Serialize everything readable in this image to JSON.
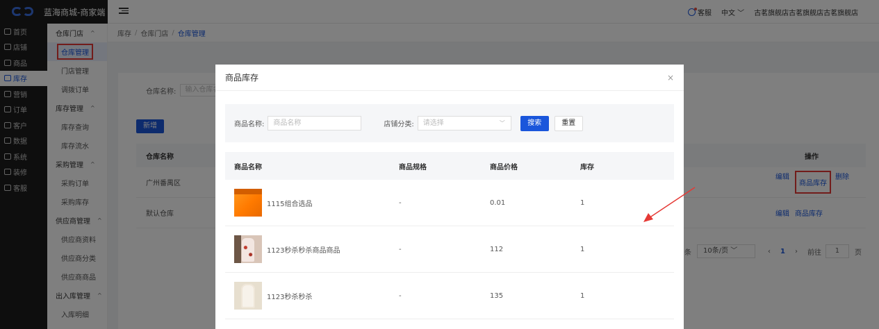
{
  "app": {
    "title": "蓝海商城-商家端",
    "service_label": "客服",
    "language": "中文",
    "store_name": "古茗旗舰店古茗旗舰店古茗旗舰店"
  },
  "sidebar": {
    "items": [
      {
        "label": "首页",
        "icon": "home-icon"
      },
      {
        "label": "店铺",
        "icon": "shop-icon"
      },
      {
        "label": "商品",
        "icon": "goods-icon"
      },
      {
        "label": "库存",
        "icon": "stock-icon"
      },
      {
        "label": "营销",
        "icon": "marketing-icon"
      },
      {
        "label": "订单",
        "icon": "order-icon"
      },
      {
        "label": "客户",
        "icon": "customer-icon"
      },
      {
        "label": "数据",
        "icon": "data-icon"
      },
      {
        "label": "系统",
        "icon": "system-icon"
      },
      {
        "label": "装修",
        "icon": "decorate-icon"
      },
      {
        "label": "客服",
        "icon": "service-icon"
      }
    ]
  },
  "submenu": {
    "group1": "仓库门店",
    "warehouse_manage": "仓库管理",
    "store_manage": "门店管理",
    "transfer_order": "调拨订单",
    "group2": "库存管理",
    "stock_query": "库存查询",
    "stock_flow": "库存流水",
    "group3": "采购管理",
    "purchase_order": "采购订单",
    "purchase_stock": "采购库存",
    "group4": "供应商管理",
    "supplier_info": "供应商资料",
    "supplier_category": "供应商分类",
    "supplier_goods": "供应商商品",
    "group5": "出入库管理",
    "inbound_detail": "入库明细"
  },
  "breadcrumb": {
    "items": [
      "库存",
      "仓库门店",
      "仓库管理"
    ]
  },
  "main": {
    "search_label": "仓库名称:",
    "search_placeholder": "输入仓库名",
    "new_button": "新增",
    "col_name": "仓库名称",
    "col_ops": "操作",
    "rows": [
      {
        "name": "广州番禺区",
        "edit": "编辑",
        "stock": "商品库存",
        "delete": "删除"
      },
      {
        "name": "默认仓库",
        "edit": "编辑",
        "stock": "商品库存"
      }
    ],
    "pager": {
      "total_suffix": "条",
      "page_size": "10条/页",
      "prev": "‹",
      "current": "1",
      "next": "›",
      "goto_label": "前往",
      "goto_value": "1",
      "page_suffix": "页"
    }
  },
  "modal": {
    "title": "商品库存",
    "close": "×",
    "filter": {
      "name_label": "商品名称:",
      "name_placeholder": "商品名称",
      "category_label": "店铺分类:",
      "category_placeholder": "请选择",
      "search_button": "搜索",
      "reset_button": "重置"
    },
    "columns": [
      "商品名称",
      "商品规格",
      "商品价格",
      "库存"
    ],
    "rows": [
      {
        "name": "1115组合选品",
        "spec": "-",
        "price": "0.01",
        "stock": "1"
      },
      {
        "name": "1123秒杀秒杀商品商品",
        "spec": "-",
        "price": "112",
        "stock": "1"
      },
      {
        "name": "1123秒杀秒杀",
        "spec": "-",
        "price": "135",
        "stock": "1"
      }
    ]
  },
  "colors": {
    "primary": "#1a56db",
    "sidebar_bg": "#1c1c1c",
    "annotation": "#e53935"
  }
}
